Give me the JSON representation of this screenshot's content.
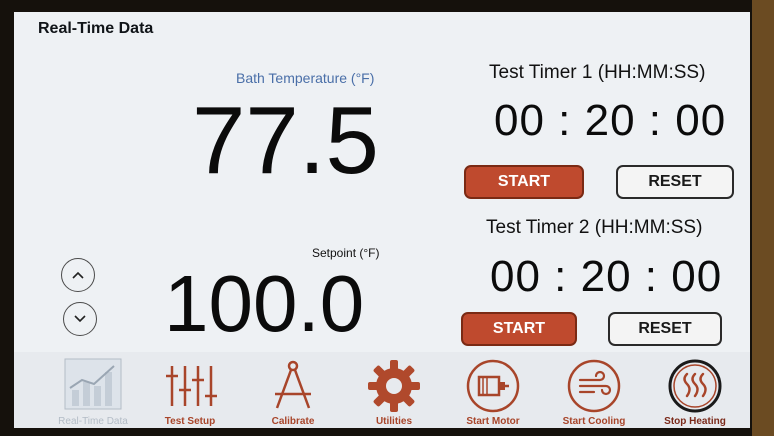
{
  "app": {
    "title": "Real-Time Data"
  },
  "bath": {
    "label": "Bath Temperature (°F)",
    "value": "77.5"
  },
  "setpoint": {
    "label": "Setpoint (°F)",
    "value": "100.0"
  },
  "timer1": {
    "title": "Test Timer 1 (HH:MM:SS)",
    "time": "00 : 20 : 00",
    "start_label": "START",
    "reset_label": "RESET"
  },
  "timer2": {
    "title": "Test Timer 2 (HH:MM:SS)",
    "time": "00 : 20 : 00",
    "start_label": "START",
    "reset_label": "RESET"
  },
  "toolbar": {
    "items": [
      {
        "label": "Real-Time Data",
        "icon": "bar-chart-icon"
      },
      {
        "label": "Test Setup",
        "icon": "sliders-icon"
      },
      {
        "label": "Calibrate",
        "icon": "compass-icon"
      },
      {
        "label": "Utilities",
        "icon": "gear-icon"
      },
      {
        "label": "Start Motor",
        "icon": "motor-icon"
      },
      {
        "label": "Start Cooling",
        "icon": "wind-icon"
      },
      {
        "label": "Stop Heating",
        "icon": "heat-icon"
      }
    ]
  },
  "colors": {
    "accent": "#bf4a2e",
    "label_blue": "#4a6fa8",
    "screen_bg": "#eef1f4"
  }
}
